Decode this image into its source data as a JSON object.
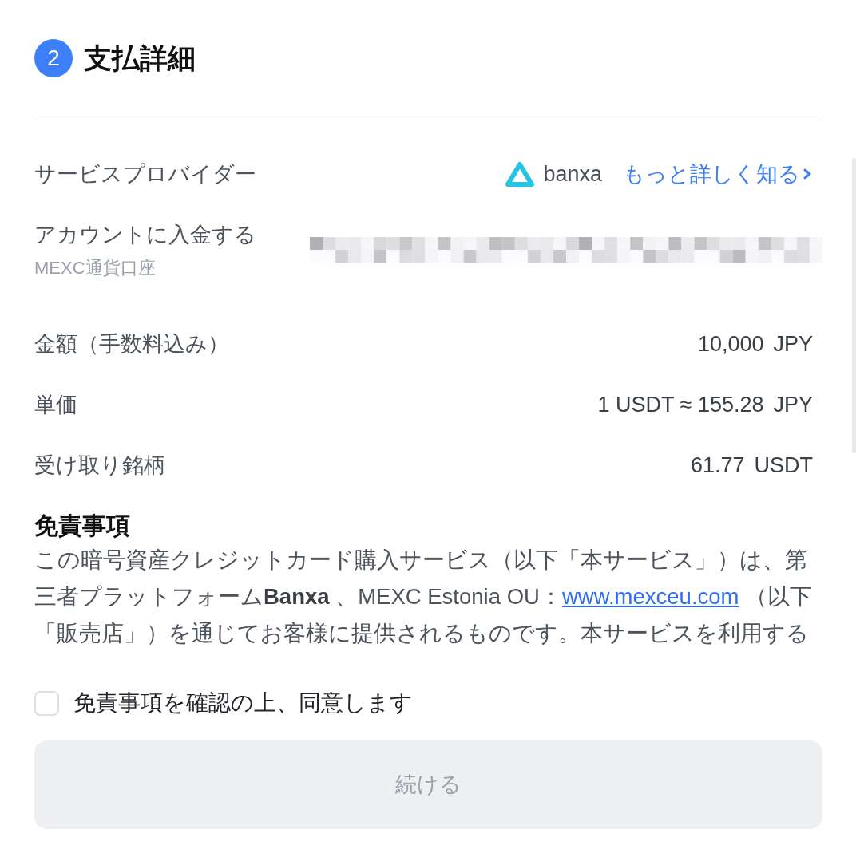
{
  "step": {
    "number": "2",
    "title": "支払詳細"
  },
  "details": [
    {
      "kind": "provider",
      "label": "サービスプロバイダー",
      "provider_name": "banxa",
      "link": "もっと詳しく知る"
    },
    {
      "kind": "account",
      "label": "アカウントに入金する",
      "sublabel": "MEXC通貨口座"
    },
    {
      "kind": "amount",
      "label": "金額（手数料込み）",
      "value": "10,000",
      "unit": "JPY"
    },
    {
      "kind": "amount",
      "label": "単価",
      "value": "1 USDT ≈ 155.28",
      "unit": "JPY"
    },
    {
      "kind": "amount",
      "label": "受け取り銘柄",
      "value": "61.77",
      "unit": "USDT"
    }
  ],
  "disclaimer": {
    "title": "免責事項",
    "lines": [
      {
        "text": "この暗号資産クレジットカード購入サービス（以下「本サービス」）は、第"
      },
      {
        "text": "三者プラットフォーム**Banxa** 、MEXC Estonia OU：",
        "link": "www.mexceu.com",
        "text_after": " （以下"
      },
      {
        "text": "「販売店」）を通じてお客様に提供されるものです。本サービスを利用する"
      }
    ]
  },
  "agreement": {
    "label": "免責事項を確認の上、同意します",
    "checked": false
  },
  "continue_button": {
    "label": "続ける",
    "disabled": true
  }
}
